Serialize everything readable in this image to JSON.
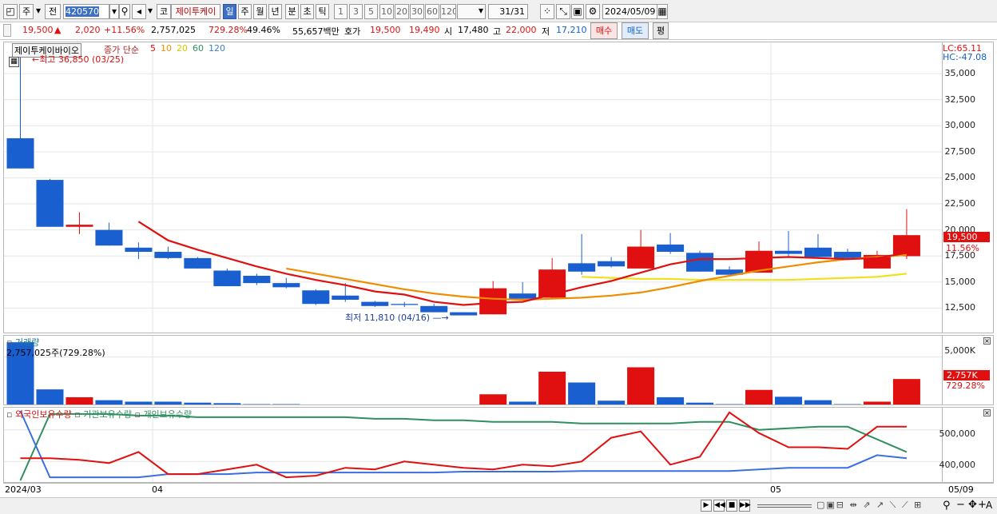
{
  "toolbar": {
    "market": "주",
    "prev": "전",
    "code": "420570",
    "mode": "코",
    "name": "제이투케이",
    "periods": [
      "일",
      "주",
      "월",
      "년",
      "분",
      "초",
      "틱"
    ],
    "active_period": "일",
    "counts": [
      "1",
      "3",
      "5",
      "10",
      "20",
      "30",
      "60",
      "120"
    ],
    "page": "31/31",
    "date": "2024/05/09",
    "icons": [
      "display-icon",
      "dropdown-icon",
      "search-icon",
      "speaker-icon",
      "calendar-icon",
      "settings-icon",
      "save-icon"
    ]
  },
  "quote": {
    "price": "19,500",
    "change": "2,020",
    "change_pct": "+11.56%",
    "volume": "2,757,025",
    "volume_pct": "729.28%",
    "turnover": "49.46%",
    "amount": "55,657백만",
    "ask_label": "호가",
    "ask": "19,500",
    "bid": "19,490",
    "open_label": "시",
    "open": "17,480",
    "high_label": "고",
    "high": "22,000",
    "low_label": "저",
    "low": "17,210",
    "buy_label": "매수",
    "sell_label": "매도",
    "avg_label": "평"
  },
  "price_panel": {
    "title": "제이투케이바이오",
    "ma_label": "종가 단순",
    "ma_periods": [
      "5",
      "10",
      "20",
      "60",
      "120"
    ],
    "high_note": "최고 36,850 (03/25)",
    "low_note": "최저 11,810 (04/16)",
    "lc": "LC:65.11",
    "hc": "HC:-47.08",
    "current_tag": "19,500",
    "current_pct": "11.56%",
    "yticks": [
      "35,000",
      "32,500",
      "30,000",
      "27,500",
      "25,000",
      "22,500",
      "20,000",
      "17,500",
      "15,000",
      "12,500"
    ]
  },
  "volume_panel": {
    "title": "거래량",
    "value": "2,757,025주(729.28%)",
    "ytick": "5,000K",
    "current_tag": "2,757K",
    "current_pct": "729.28%"
  },
  "holding_panel": {
    "legend": [
      "외국인보유수량",
      "기관보유수량",
      "개인보유수량"
    ],
    "yticks": [
      "500,000",
      "400,000"
    ]
  },
  "xaxis": {
    "labels": [
      "2024/03",
      "04",
      "05",
      "05/09"
    ]
  },
  "colors": {
    "up": "#e01010",
    "down": "#1a5fd0",
    "ma5": "#e01010",
    "ma10": "#f08c00",
    "ma20": "#f0e020",
    "foreign": "#e01010",
    "institution": "#2f8f5f",
    "individual": "#3a6fe0"
  },
  "chart_data": {
    "type": "candlestick",
    "ylim": [
      10000,
      38000
    ],
    "candles": [
      {
        "o": 28800,
        "h": 36850,
        "l": 25900,
        "c": 25900
      },
      {
        "o": 24800,
        "h": 24900,
        "l": 20300,
        "c": 20300
      },
      {
        "o": 20300,
        "h": 21700,
        "l": 19600,
        "c": 20500
      },
      {
        "o": 20000,
        "h": 20700,
        "l": 18500,
        "c": 18500
      },
      {
        "o": 18300,
        "h": 18800,
        "l": 17200,
        "c": 17900
      },
      {
        "o": 17900,
        "h": 18400,
        "l": 17200,
        "c": 17300
      },
      {
        "o": 17300,
        "h": 17400,
        "l": 16300,
        "c": 16300
      },
      {
        "o": 16100,
        "h": 16300,
        "l": 14600,
        "c": 14600
      },
      {
        "o": 15600,
        "h": 15800,
        "l": 14700,
        "c": 14900
      },
      {
        "o": 14900,
        "h": 15400,
        "l": 14400,
        "c": 14500
      },
      {
        "o": 14200,
        "h": 14300,
        "l": 12800,
        "c": 12900
      },
      {
        "o": 13700,
        "h": 14900,
        "l": 13100,
        "c": 13300
      },
      {
        "o": 13100,
        "h": 13200,
        "l": 12600,
        "c": 12700
      },
      {
        "o": 12900,
        "h": 13100,
        "l": 12600,
        "c": 12800
      },
      {
        "o": 12700,
        "h": 12900,
        "l": 12100,
        "c": 12100
      },
      {
        "o": 12100,
        "h": 12100,
        "l": 11810,
        "c": 11800
      },
      {
        "o": 11900,
        "h": 15100,
        "l": 11900,
        "c": 14400
      },
      {
        "o": 13900,
        "h": 15000,
        "l": 13300,
        "c": 13400
      },
      {
        "o": 13500,
        "h": 17300,
        "l": 13400,
        "c": 16200
      },
      {
        "o": 16800,
        "h": 19600,
        "l": 15700,
        "c": 16000
      },
      {
        "o": 17000,
        "h": 17400,
        "l": 16400,
        "c": 16500
      },
      {
        "o": 16300,
        "h": 20000,
        "l": 16300,
        "c": 18400
      },
      {
        "o": 18600,
        "h": 19700,
        "l": 17700,
        "c": 17900
      },
      {
        "o": 17800,
        "h": 18000,
        "l": 16000,
        "c": 16000
      },
      {
        "o": 16200,
        "h": 16500,
        "l": 15800,
        "c": 15700
      },
      {
        "o": 15900,
        "h": 18900,
        "l": 15900,
        "c": 18000
      },
      {
        "o": 18000,
        "h": 19900,
        "l": 17500,
        "c": 17700
      },
      {
        "o": 18300,
        "h": 19600,
        "l": 17300,
        "c": 17400
      },
      {
        "o": 17900,
        "h": 18200,
        "l": 17200,
        "c": 17300
      },
      {
        "o": 16300,
        "h": 18000,
        "l": 16300,
        "c": 17600
      },
      {
        "o": 17480,
        "h": 22000,
        "l": 17210,
        "c": 19500
      }
    ],
    "ma5": [
      null,
      null,
      null,
      null,
      20800,
      19000,
      18100,
      17300,
      16500,
      15800,
      15200,
      14700,
      14100,
      13800,
      13100,
      12800,
      13000,
      13100,
      13800,
      14500,
      15100,
      15900,
      16700,
      17200,
      17200,
      17300,
      17400,
      17300,
      17200,
      17300,
      17800
    ],
    "ma10": [
      null,
      null,
      null,
      null,
      null,
      null,
      null,
      null,
      null,
      16300,
      15800,
      15300,
      14800,
      14300,
      13900,
      13600,
      13400,
      13300,
      13400,
      13500,
      13700,
      14000,
      14500,
      15100,
      15600,
      16100,
      16500,
      16900,
      17200,
      17400,
      17600
    ],
    "ma20": [
      null,
      null,
      null,
      null,
      null,
      null,
      null,
      null,
      null,
      null,
      null,
      null,
      null,
      null,
      null,
      null,
      null,
      null,
      null,
      15500,
      15400,
      15300,
      15300,
      15200,
      15200,
      15200,
      15200,
      15300,
      15400,
      15500,
      15800
    ],
    "volume_k": [
      6500,
      1700,
      900,
      600,
      450,
      450,
      350,
      300,
      200,
      200,
      150,
      150,
      150,
      150,
      150,
      150,
      1200,
      450,
      3500,
      2400,
      550,
      3950,
      900,
      350,
      200,
      1650,
      950,
      600,
      200,
      450,
      2757
    ],
    "foreign": [
      410000,
      410000,
      405000,
      395000,
      430000,
      360000,
      360000,
      375000,
      390000,
      350000,
      355000,
      380000,
      375000,
      400000,
      390000,
      380000,
      375000,
      390000,
      385000,
      400000,
      475000,
      495000,
      390000,
      415000,
      555000,
      490000,
      445000,
      445000,
      440000,
      510000,
      510000
    ],
    "institution": [
      340000,
      550000,
      550000,
      550000,
      545000,
      545000,
      540000,
      540000,
      540000,
      540000,
      540000,
      540000,
      535000,
      535000,
      530000,
      530000,
      525000,
      525000,
      525000,
      520000,
      520000,
      520000,
      520000,
      525000,
      525000,
      500000,
      505000,
      510000,
      510000,
      470000,
      430000
    ],
    "individual": [
      560000,
      350000,
      350000,
      350000,
      350000,
      360000,
      360000,
      360000,
      365000,
      365000,
      365000,
      365000,
      365000,
      365000,
      365000,
      368000,
      368000,
      368000,
      368000,
      370000,
      370000,
      370000,
      370000,
      370000,
      370000,
      375000,
      380000,
      380000,
      380000,
      420000,
      410000
    ]
  }
}
